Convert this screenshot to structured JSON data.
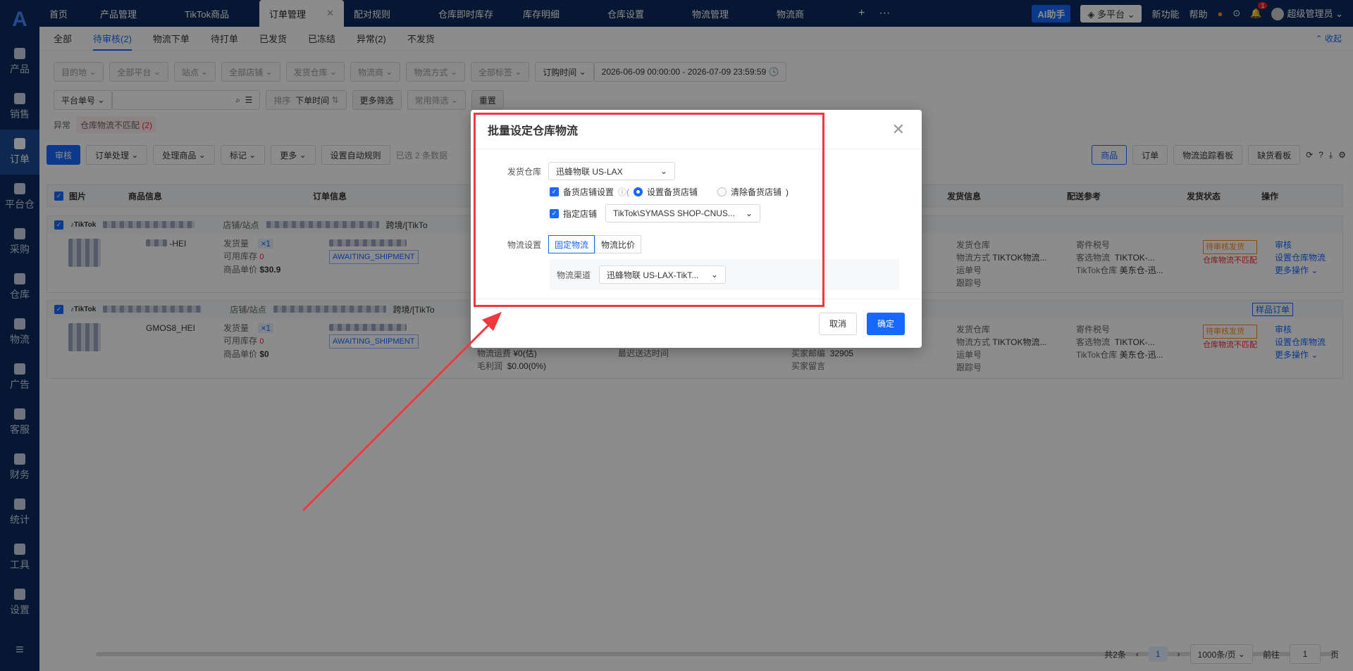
{
  "sidebar": {
    "items": [
      {
        "label": "产品"
      },
      {
        "label": "销售"
      },
      {
        "label": "订单",
        "active": true
      },
      {
        "label": "平台仓"
      },
      {
        "label": "采购"
      },
      {
        "label": "仓库"
      },
      {
        "label": "物流"
      },
      {
        "label": "广告"
      },
      {
        "label": "客服"
      },
      {
        "label": "财务"
      },
      {
        "label": "统计"
      },
      {
        "label": "工具"
      },
      {
        "label": "设置"
      }
    ],
    "menu_icon": "≡"
  },
  "topbar": {
    "tabs": [
      "首页",
      "产品管理",
      "TikTok商品",
      "订单管理",
      "配对规则",
      "仓库即时库存",
      "库存明细",
      "仓库设置",
      "物流管理",
      "物流商"
    ],
    "add": "+",
    "more": "···",
    "ai": "AI助手",
    "platform": "多平台",
    "new": "新功能",
    "help": "帮助",
    "bell_count": "1",
    "user": "超级管理员"
  },
  "subtabs": [
    {
      "label": "全部"
    },
    {
      "label": "待审核(2)",
      "active": true
    },
    {
      "label": "物流下单"
    },
    {
      "label": "待打单"
    },
    {
      "label": "已发货"
    },
    {
      "label": "已冻结"
    },
    {
      "label": "异常(2)"
    },
    {
      "label": "不发货"
    }
  ],
  "collapse": "收起",
  "filters": [
    "目的地",
    "全部平台",
    "站点",
    "全部店铺",
    "发货仓库",
    "物流商",
    "物流方式",
    "全部标签"
  ],
  "order_time": {
    "label": "订购时间",
    "range": "2026-06-09 00:00:00  -  2026-07-09 23:59:59"
  },
  "row2": {
    "platform_no": "平台单号",
    "sort_label": "排序",
    "sort_value": "下单时间",
    "more_filter": "更多筛选",
    "common_filter": "常用筛选",
    "reset": "重置"
  },
  "abnormal": {
    "label": "异常",
    "chip": "仓库物流不匹配",
    "count": "(2)"
  },
  "toolbar": {
    "left": [
      "审核",
      "订单处理",
      "处理商品",
      "标记",
      "更多",
      "设置自动规则"
    ],
    "selected": "已选 2 条数据",
    "right": [
      "商品",
      "订单",
      "物流追踪看板",
      "缺货看板"
    ]
  },
  "table_headers": [
    "图片",
    "商品信息",
    "订单信息",
    "发货信息",
    "配送参考",
    "发货状态",
    "操作"
  ],
  "orders": [
    {
      "store_label": "店铺/站点",
      "cross": "跨境/[TikTo",
      "sku": "-HEI",
      "qty_label": "发货量",
      "qty": "×1",
      "stock_label": "可用库存",
      "stock": "0",
      "price_label": "商品单价",
      "price": "$30.9",
      "status": "AWAITING_SHIPMENT",
      "ship_labels": [
        "发货仓库",
        "物流方式",
        "运单号",
        "跟踪号"
      ],
      "ship_method": "TIKTOK物流...",
      "ref_labels": [
        "寄件税号",
        "客选物流",
        "TikTok仓库"
      ],
      "ref_tiktok": "TIKTOK-...",
      "ref_wh": "美东仓-迅...",
      "state1": "待审核发货",
      "state2": "仓库物流不匹配",
      "ops": [
        "审核",
        "设置仓库物流",
        "更多操作"
      ]
    },
    {
      "store_label": "店铺/站点",
      "cross": "跨境/[TikTo",
      "sku": "GMOS8_HEI",
      "qty_label": "发货量",
      "qty": "×1",
      "stock_label": "可用库存",
      "stock": "0",
      "price_label": "商品单价",
      "price": "$0",
      "status": "AWAITING_SHIPMENT",
      "ship_labels": [
        "发货仓库",
        "物流方式",
        "运单号",
        "跟踪号"
      ],
      "ship_method": "TIKTOK物流...",
      "ref_labels": [
        "寄件税号",
        "客选物流",
        "TikTok仓库"
      ],
      "ref_tiktok": "TIKTOK-...",
      "ref_wh": "美东仓-迅...",
      "state1": "待审核发货",
      "state2": "仓库物流不匹配",
      "ops": [
        "审核",
        "设置仓库物流",
        "更多操作"
      ],
      "tag": "样品订单",
      "extra": {
        "fee_label": "物流运费",
        "fee": "¥0(估)",
        "profit_label": "毛利润",
        "profit": "$0.00(0%)",
        "deliver_label": "最迟送达时间",
        "zip_label": "买家邮编",
        "zip": "32905",
        "msg_label": "买家留言"
      }
    }
  ],
  "pager": {
    "total": "共2条",
    "page": "1",
    "size": "1000条/页",
    "goto": "前往",
    "goto_val": "1",
    "page_unit": "页"
  },
  "modal": {
    "title": "批量设定仓库物流",
    "warehouse_label": "发货仓库",
    "warehouse_value": "迅蜂物联 US-LAX",
    "backup_label": "备货店铺设置",
    "backup_set": "设置备货店铺",
    "backup_clear": "清除备货店铺",
    "store_label": "指定店铺",
    "store_value": "TikTok\\SYMASS SHOP-CNUS...",
    "logistics_label": "物流设置",
    "seg_fixed": "固定物流",
    "seg_ratio": "物流比价",
    "channel_label": "物流渠道",
    "channel_value": "迅蜂物联 US-LAX-TikT...",
    "cancel": "取消",
    "ok": "确定"
  },
  "colors": {
    "sidebar": "#0a2a5c",
    "primary": "#1668ff",
    "highlight": "#f0393e"
  }
}
